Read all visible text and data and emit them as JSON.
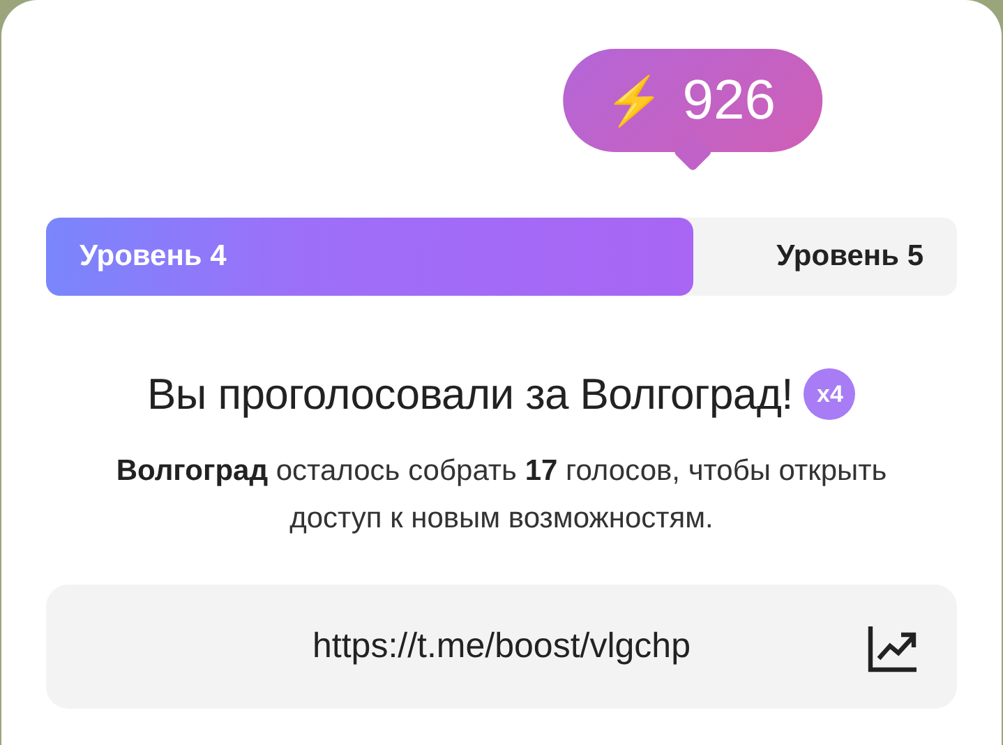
{
  "boost": {
    "icon": "⚡",
    "count": "926"
  },
  "level_bar": {
    "level": 0.71,
    "current": "Уровень 4",
    "next": "Уровень 5"
  },
  "title": "Вы проголосовали за Волгоград!",
  "multiplier": "x4",
  "description": "**Волгоград** осталось собрать **17** голосов, чтобы открыть доступ к новым возможностям.",
  "link": {
    "value": "https://t.me/boost/vlgchp"
  }
}
